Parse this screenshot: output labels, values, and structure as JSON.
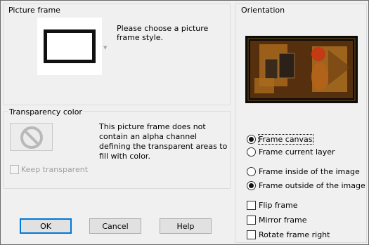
{
  "picture_frame": {
    "title": "Picture frame",
    "description": "Please choose a picture\nframe style.",
    "dropdown_icon": "chevron-down-icon"
  },
  "transparency": {
    "title": "Transparency color",
    "description": "This picture frame does not\ncontain an alpha channel\ndefining the transparent areas to\nfill with color.",
    "swatch_icon": "no-symbol-icon",
    "keep_transparent_label": "Keep transparent",
    "keep_transparent_checked": false
  },
  "orientation": {
    "title": "Orientation",
    "preview_icon": "image-preview",
    "options": [
      {
        "label": "Frame canvas",
        "selected": true
      },
      {
        "label": "Frame current layer",
        "selected": false
      }
    ],
    "placement": [
      {
        "label": "Frame inside of the image",
        "selected": false
      },
      {
        "label": "Frame outside of the image",
        "selected": true
      }
    ],
    "checkboxes": [
      {
        "label": "Flip frame",
        "checked": false
      },
      {
        "label": "Mirror frame",
        "checked": false
      },
      {
        "label": "Rotate frame right",
        "checked": false
      }
    ]
  },
  "buttons": {
    "ok": "OK",
    "cancel": "Cancel",
    "help": "Help"
  },
  "colors": {
    "accent": "#0078d7",
    "background": "#f0f0f0",
    "frame": "#111111"
  }
}
